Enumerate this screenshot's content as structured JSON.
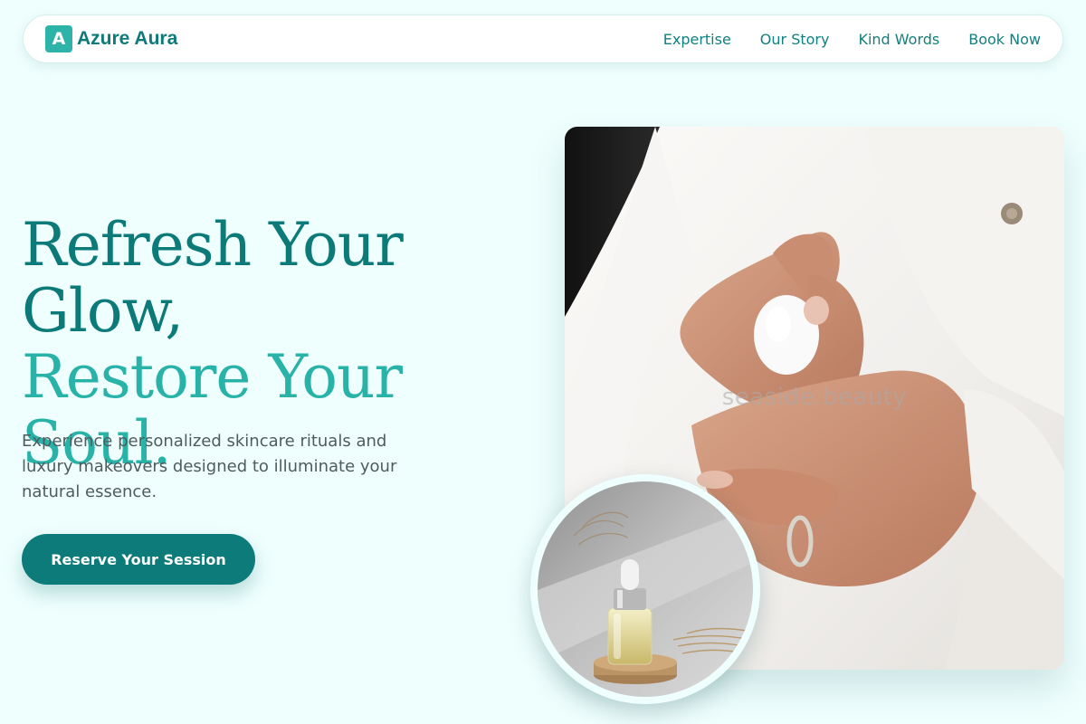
{
  "brand": {
    "mark": "A",
    "name": "Azure Aura"
  },
  "nav": {
    "links": [
      "Expertise",
      "Our Story",
      "Kind Words",
      "Book Now"
    ]
  },
  "hero": {
    "headline_line1": "Refresh Your Glow,",
    "headline_line2": "Restore Your Soul.",
    "subtitle": "Experience personalized skincare rituals and luxury makeovers designed to illuminate your natural essence.",
    "cta_label": "Reserve Your Session",
    "image_watermark": "seaside.beauty"
  },
  "colors": {
    "background": "#effffe",
    "primary": "#0c7b7a",
    "accent": "#29b3a8"
  }
}
